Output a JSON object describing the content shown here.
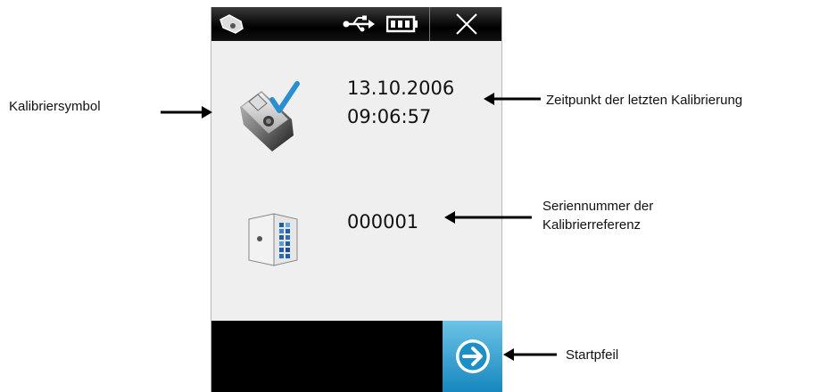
{
  "screen": {
    "calibration_date": "13.10.2006",
    "calibration_time": "09:06:57",
    "serial_number": "000001"
  },
  "topbar": {
    "device_icon": "device-icon",
    "usb_icon": "usb-icon",
    "battery_icon": "battery-icon",
    "close_icon": "close-icon"
  },
  "annotations": {
    "calibration_symbol": "Kalibriersymbol",
    "last_calibration_time": "Zeitpunkt der letzten Kalibrierung",
    "serial_line1": "Seriennummer der",
    "serial_line2": "Kalibrierreferenz",
    "start_arrow": "Startpfeil"
  },
  "colors": {
    "accent": "#1b8fc6",
    "bar": "#000000",
    "screen": "#efefef"
  }
}
